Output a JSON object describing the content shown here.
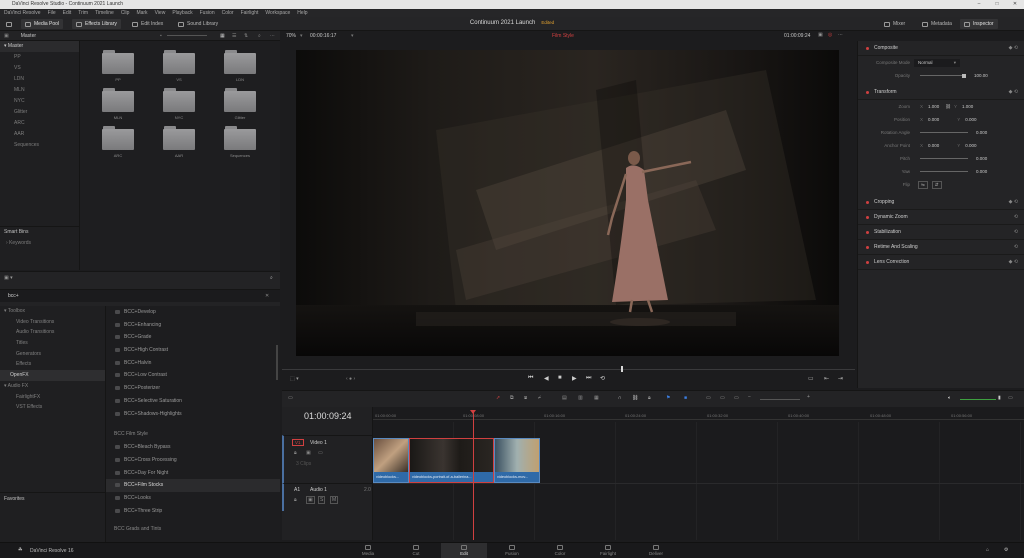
{
  "window": {
    "title": "DaVinci Resolve Studio - Continuum 2021 Launch",
    "controls": [
      "–",
      "□",
      "✕"
    ]
  },
  "menu": [
    "DaVinci Resolve",
    "File",
    "Edit",
    "Trim",
    "Timeline",
    "Clip",
    "Mark",
    "View",
    "Playback",
    "Fusion",
    "Color",
    "Fairlight",
    "Workspace",
    "Help"
  ],
  "toolbar": {
    "media_pool": "Media Pool",
    "effects_library": "Effects Library",
    "edit_index": "Edit Index",
    "sound_library": "Sound Library",
    "project_title": "Continuum 2021 Launch",
    "project_status": "Edited",
    "mixer": "Mixer",
    "metadata": "Metadata",
    "inspector": "Inspector"
  },
  "media_pool": {
    "header": "Master",
    "root": "Master",
    "bins": [
      "PP",
      "VS",
      "LDN",
      "MLN",
      "NYC",
      "Glitter",
      "ARC",
      "AAR",
      "Sequences"
    ],
    "folders": [
      "PP",
      "VS",
      "LDN",
      "MLN",
      "NYC",
      "Glitter",
      "ARC",
      "AAR",
      "Sequences"
    ],
    "smart_bins": "Smart Bins",
    "keywords": "Keywords"
  },
  "effects": {
    "search_value": "bcc+",
    "tree": [
      {
        "label": "Toolbox",
        "top": true
      },
      {
        "label": "Video Transitions"
      },
      {
        "label": "Audio Transitions"
      },
      {
        "label": "Titles"
      },
      {
        "label": "Generators"
      },
      {
        "label": "Effects"
      },
      {
        "label": "OpenFX",
        "top": true,
        "selected": true
      },
      {
        "label": "Audio FX",
        "top": true
      },
      {
        "label": "FairlightFX"
      },
      {
        "label": "VST Effects"
      }
    ],
    "list": [
      "BCC+Develop",
      "BCC+Enhancing",
      "BCC+Grade",
      "BCC+High Contrast",
      "BCC+Halvin",
      "BCC+Low Contrast",
      "BCC+Posterizer",
      "BCC+Selective Saturation",
      "BCC+Shadows-Highlights"
    ],
    "group_title": "BCC Film Style",
    "group_list": [
      "BCC+Bleach Bypass",
      "BCC+Cross Processing",
      "BCC+Day For Night",
      "BCC+Film Stocks",
      "BCC+Looks",
      "BCC+Three Strip"
    ],
    "group_title_2": "BCC Grads and Tints",
    "favorites": "Favorites"
  },
  "viewer": {
    "zoom": "70%",
    "source_tc": "00:00:16:17",
    "clip_name": "Film Style",
    "record_tc": "01:00:09:24"
  },
  "inspector": {
    "composite": "Composite",
    "composite_mode_label": "Composite Mode",
    "composite_mode": "Normal",
    "opacity_label": "Opacity",
    "opacity": "100.00",
    "transform": "Transform",
    "zoom_label": "Zoom",
    "zoom_x": "1.000",
    "zoom_y": "1.000",
    "position_label": "Position",
    "pos_x": "0.000",
    "pos_y": "0.000",
    "rotation_label": "Rotation Angle",
    "rotation": "0.000",
    "anchor_label": "Anchor Point",
    "anchor_x": "0.000",
    "anchor_y": "0.000",
    "pitch_label": "Pitch",
    "pitch": "0.000",
    "yaw_label": "Yaw",
    "yaw": "0.000",
    "flip_label": "Flip",
    "axis_x": "X",
    "axis_y": "Y",
    "sections": [
      "Cropping",
      "Dynamic Zoom",
      "Stabilization",
      "Retime And Scaling",
      "Lens Correction"
    ]
  },
  "timeline": {
    "timecode": "01:00:09:24",
    "ruler": [
      "01:00:00:00",
      "01:00:08:00",
      "01:00:16:00",
      "01:00:24:00",
      "01:00:32:00",
      "01:00:40:00",
      "01:00:48:00",
      "01:00:56:00"
    ],
    "video_track": {
      "id": "V1",
      "name": "Video 1",
      "count": "3 Clips"
    },
    "audio_track": {
      "id": "A1",
      "name": "Audio 1",
      "level": "2.0"
    },
    "clips": [
      "videoblocks...",
      "videoblocks-portrait-of-a-ballerina...",
      "videoblocks-mov..."
    ]
  },
  "pages": [
    "Media",
    "Cut",
    "Edit",
    "Fusion",
    "Color",
    "Fairlight",
    "Deliver"
  ],
  "active_page": "Edit",
  "app_name": "DaVinci Resolve 16",
  "colors": {
    "accent": "#d04040",
    "clip_blue": "#2f6aa8",
    "edited": "#e0a030"
  }
}
